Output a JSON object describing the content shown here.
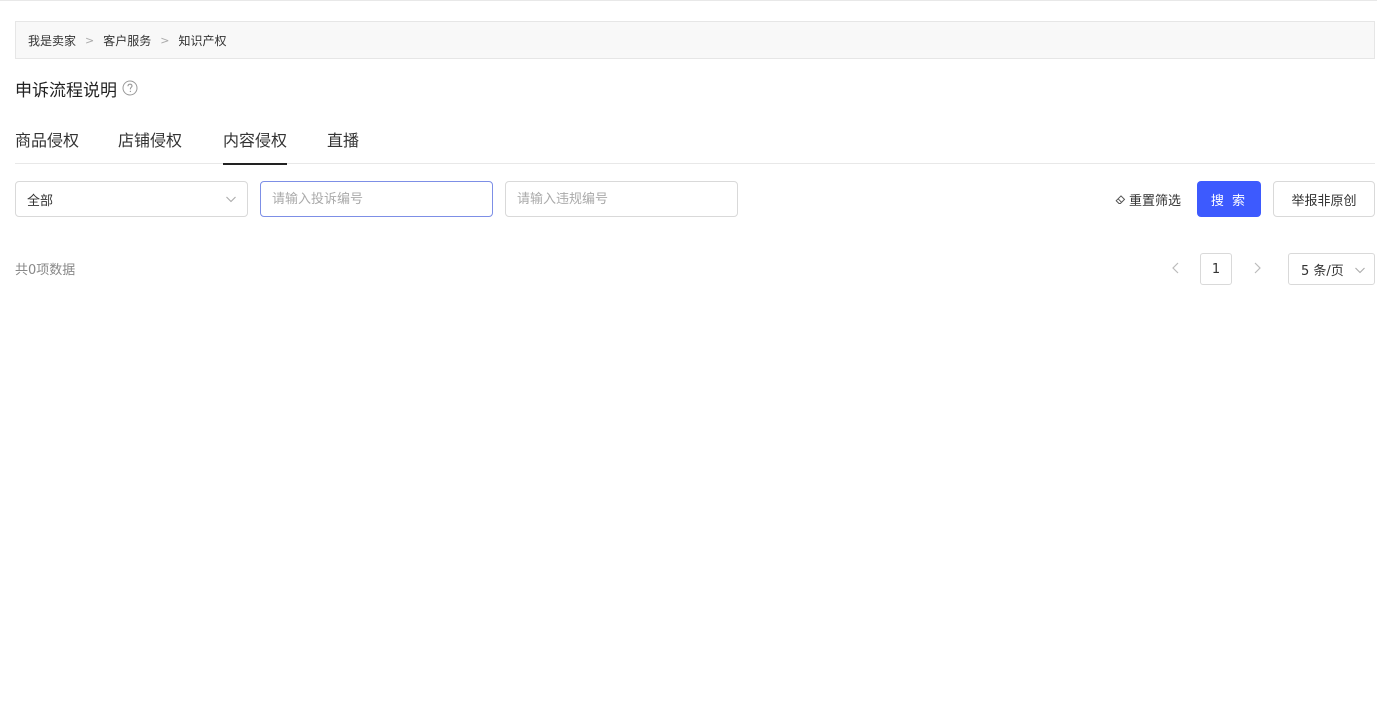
{
  "breadcrumb": {
    "items": [
      "我是卖家",
      "客户服务",
      "知识产权"
    ],
    "separator": ">"
  },
  "page": {
    "title": "申诉流程说明"
  },
  "tabs": [
    {
      "label": "商品侵权",
      "active": false
    },
    {
      "label": "店铺侵权",
      "active": false
    },
    {
      "label": "内容侵权",
      "active": true
    },
    {
      "label": "直播",
      "active": false
    }
  ],
  "filters": {
    "status_select": {
      "value": "全部"
    },
    "complaint_no": {
      "placeholder": "请输入投诉编号",
      "value": ""
    },
    "violation_no": {
      "placeholder": "请输入违规编号",
      "value": ""
    },
    "reset_label": "重置筛选",
    "search_label": "搜 索",
    "report_label": "举报非原创"
  },
  "results": {
    "total_text": "共0项数据"
  },
  "pagination": {
    "current_page": "1",
    "page_size_label": "5 条/页"
  },
  "colors": {
    "primary": "#3d5afe",
    "focus_border": "#7d8fe6"
  }
}
